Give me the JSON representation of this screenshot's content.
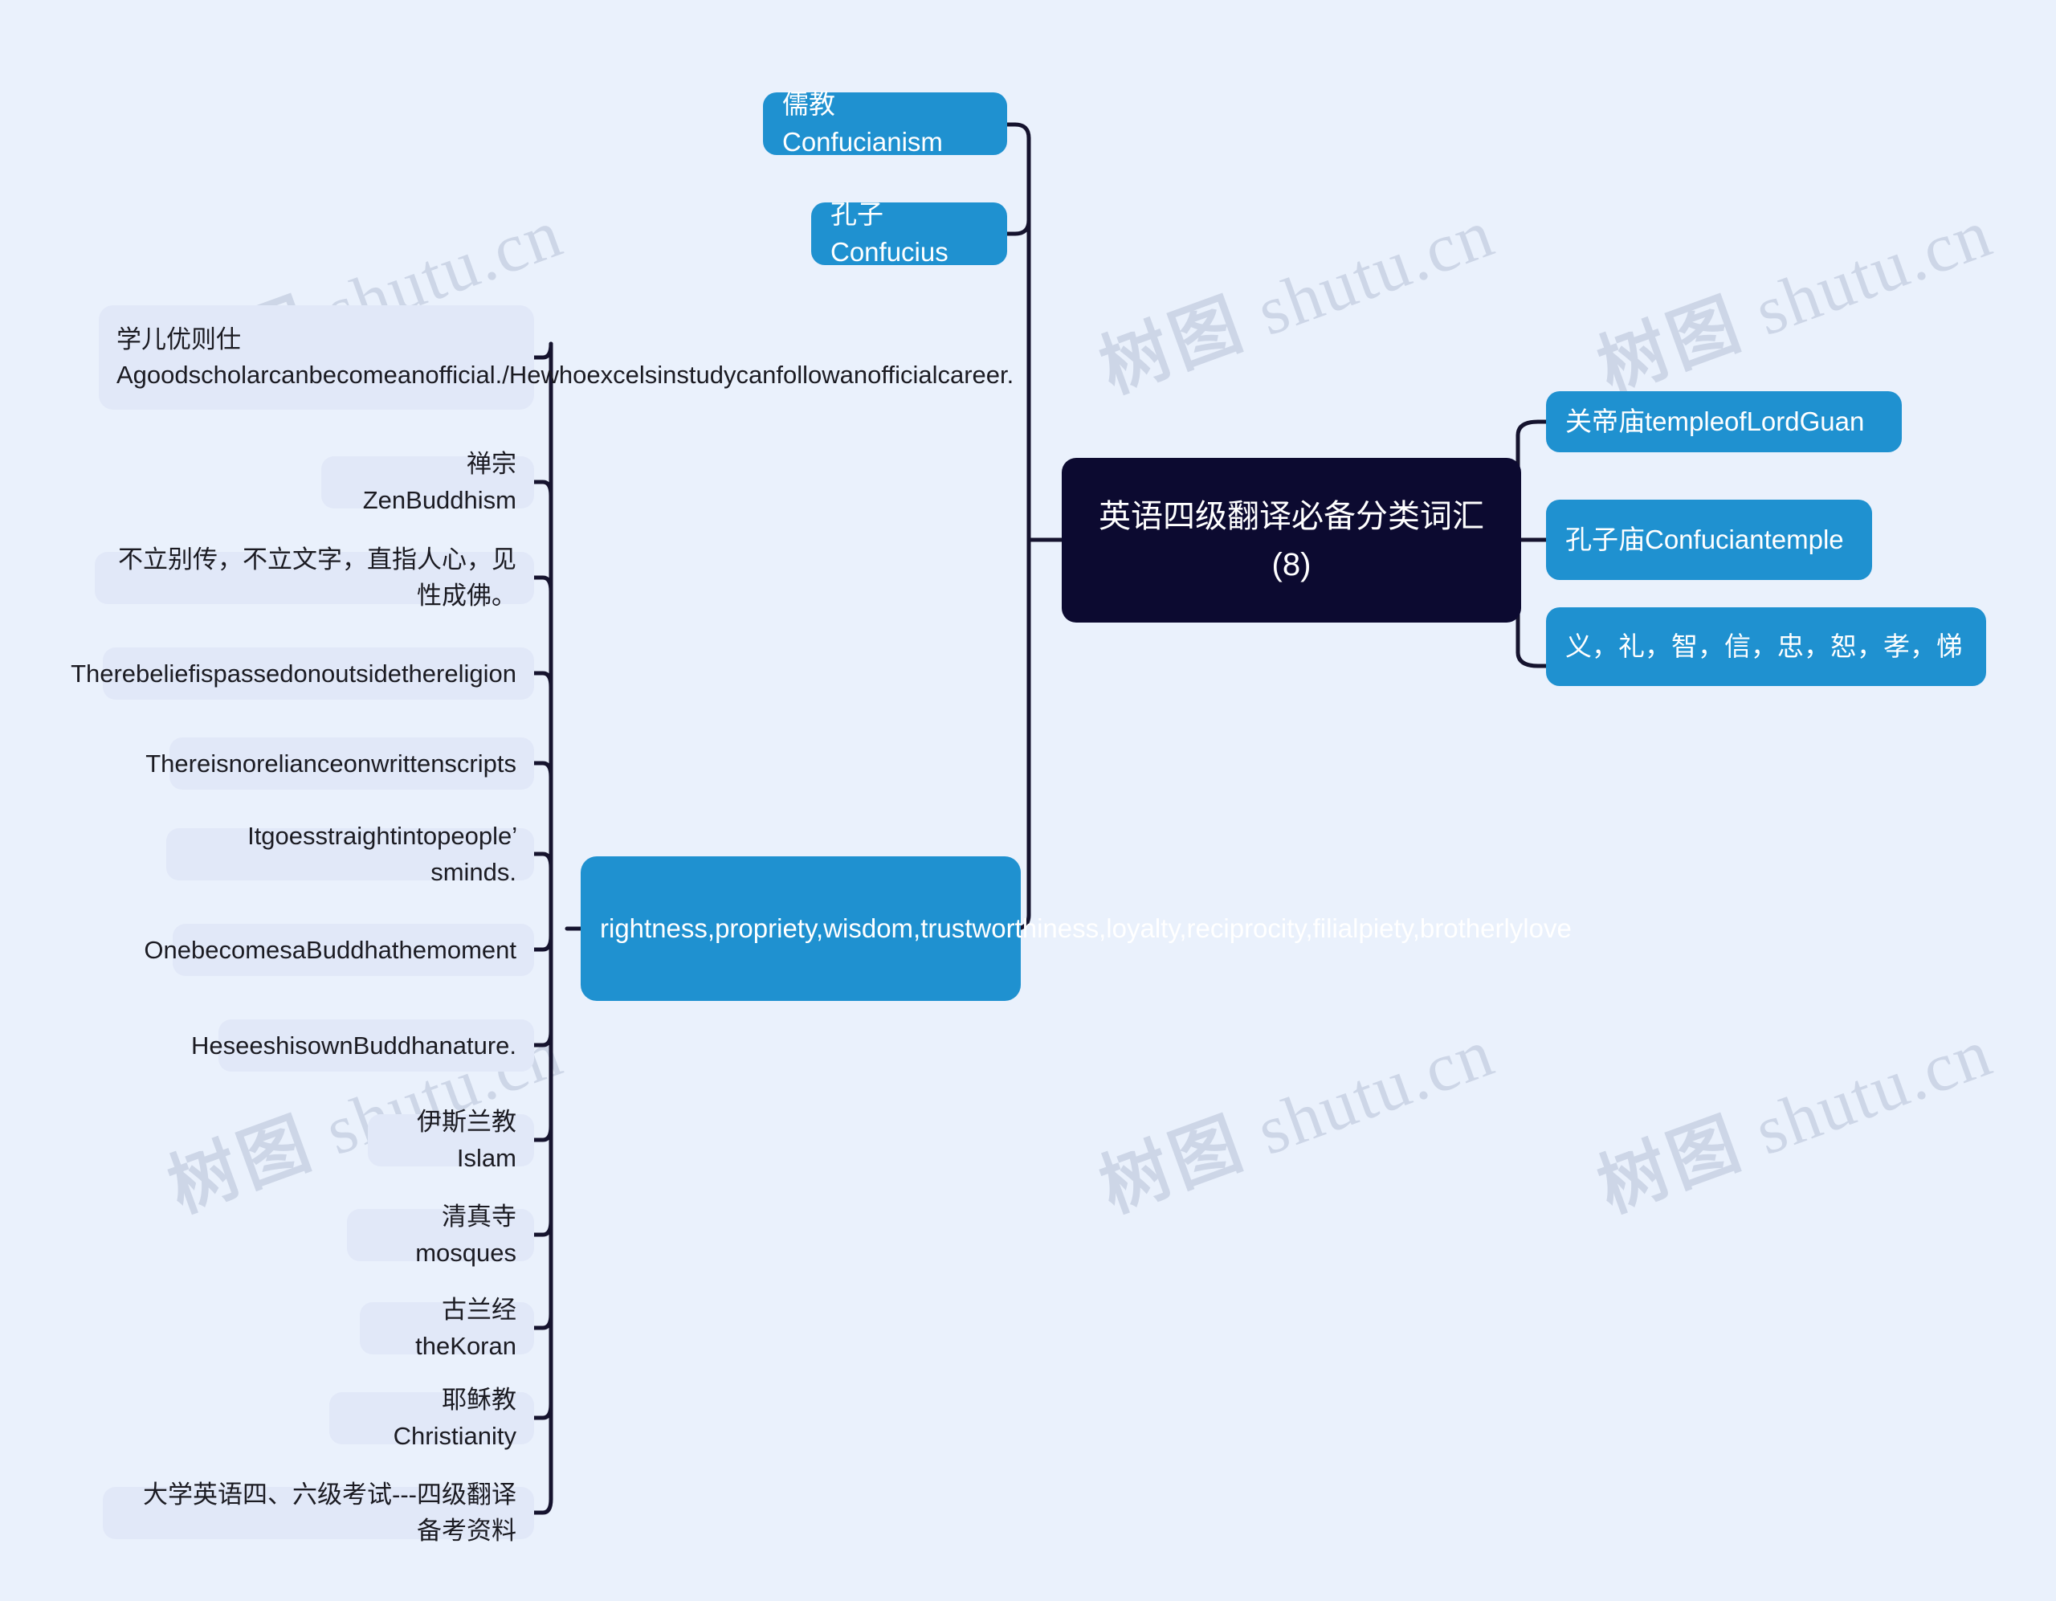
{
  "theme": {
    "canvas_bg": "#eaf1fc",
    "leaf_bg": "#e1e8f8",
    "leaf_text": "#1b1b22",
    "branch_bg": "#1f91d0",
    "branch_text": "#ffffff",
    "root_bg": "#0c0a30",
    "root_text": "#ffffff",
    "edge_color": "#15132e",
    "watermark_color": "#ccd5e6"
  },
  "watermark": {
    "cjk": "树图",
    "latin": "shutu.cn",
    "full": "树图 shutu.cn"
  },
  "root": {
    "label": "英语四级翻译必备分类词汇(8)"
  },
  "right_branch": {
    "items": [
      {
        "label": "关帝庙templeofLordGuan"
      },
      {
        "label": "孔子庙Confuciantemple"
      },
      {
        "label": "义，礼，智，信，忠，恕，孝，悌"
      }
    ]
  },
  "left_branch": {
    "items": [
      {
        "label": "儒教Confucianism"
      },
      {
        "label": "孔子Confucius"
      },
      {
        "label": "rightness,propriety,wisdom,trustworthiness,loyalty,reciprocity,filialpiety,brotherlylove"
      }
    ]
  },
  "left_leaves": {
    "items": [
      {
        "label": "学儿优则仕Agoodscholarcanbecomeanofficial./Hewhoexcelsinstudycanfollowanofficialcareer."
      },
      {
        "label": "禅宗ZenBuddhism"
      },
      {
        "label": "不立别传，不立文字，直指人心，见性成佛。"
      },
      {
        "label": "Therebeliefispassedonoutsidethereligion"
      },
      {
        "label": "Thereisnorelianceonwrittenscripts"
      },
      {
        "label": "Itgoesstraightintopeople’　sminds."
      },
      {
        "label": "OnebecomesaBuddhathemoment"
      },
      {
        "label": "HeseeshisownBuddhanature."
      },
      {
        "label": "伊斯兰教Islam"
      },
      {
        "label": "清真寺mosques"
      },
      {
        "label": "古兰经theKoran"
      },
      {
        "label": "耶稣教Christianity"
      },
      {
        "label": "大学英语四、六级考试---四级翻译备考资料"
      }
    ]
  }
}
